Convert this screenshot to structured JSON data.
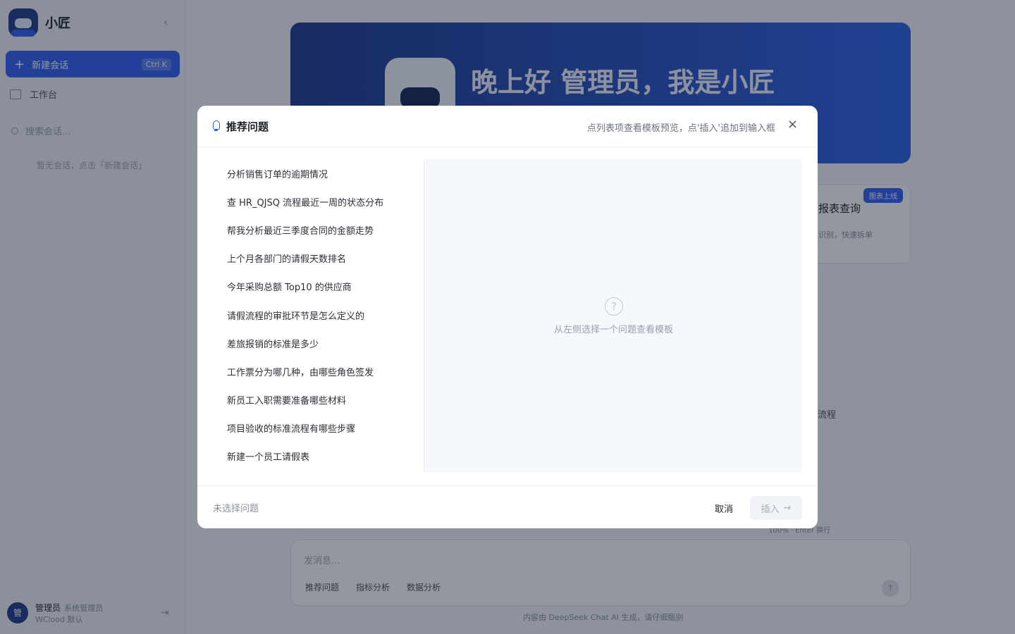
{
  "app": {
    "name": "小匠"
  },
  "sidebar": {
    "new_chat_label": "新建会话",
    "new_chat_shortcut": "Ctrl K",
    "workbench_label": "工作台",
    "search_placeholder": "搜索会话...",
    "empty_conversations": "暂无会话，点击「新建会话」",
    "user": {
      "avatar_initial": "管",
      "name": "管理员",
      "role": "系统管理员",
      "org": "WClood 默认"
    }
  },
  "main": {
    "greeting": "晚上好 管理员，我是小匠",
    "card": {
      "badge": "图表上线",
      "title": "报表查询",
      "desc": "识别，快速拆单"
    },
    "flow_select": "流程",
    "input_placeholder": "发消息...",
    "chips": [
      "推荐问题",
      "指标分析",
      "数据分析"
    ],
    "meta": "100% · Enter 换行",
    "footer": "内容由 DeepSeek Chat AI 生成，请仔细甄别"
  },
  "modal": {
    "title": "推荐问题",
    "hint": "点列表项查看模板预览，点'插入'追加到输入框",
    "questions": [
      "分析销售订单的逾期情况",
      "查 HR_QJSQ 流程最近一周的状态分布",
      "帮我分析最近三季度合同的金额走势",
      "上个月各部门的请假天数排名",
      "今年采购总额 Top10 的供应商",
      "请假流程的审批环节是怎么定义的",
      "差旅报销的标准是多少",
      "工作票分为哪几种，由哪些角色签发",
      "新员工入职需要准备哪些材料",
      "项目验收的标准流程有哪些步骤",
      "新建一个员工请假表"
    ],
    "empty_preview": "从左侧选择一个问题查看模板",
    "selection_status": "未选择问题",
    "cancel_label": "取消",
    "insert_label": "插入",
    "insert_arrow": "→",
    "close_icon": "×",
    "help_icon": "?"
  }
}
